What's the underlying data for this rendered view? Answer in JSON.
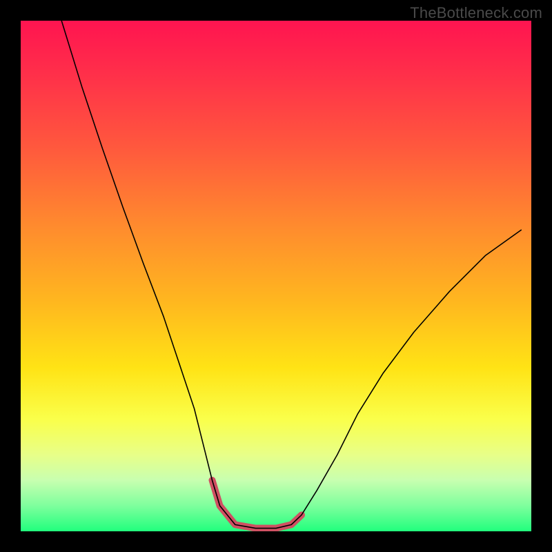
{
  "watermark": "TheBottleneck.com",
  "chart_data": {
    "type": "line",
    "title": "",
    "xlabel": "",
    "ylabel": "",
    "xlim": [
      0,
      100
    ],
    "ylim": [
      0,
      100
    ],
    "grid": false,
    "series": [
      {
        "name": "black-curve",
        "color": "#000000",
        "width": 1.6,
        "x": [
          8,
          12,
          16,
          20,
          24,
          28,
          31,
          34,
          36,
          37.5,
          39,
          42,
          46,
          50,
          53,
          55,
          58,
          62,
          66,
          71,
          77,
          84,
          91,
          98
        ],
        "y": [
          100,
          87,
          75,
          63.5,
          52.5,
          42,
          33,
          24,
          16,
          10,
          5,
          1.3,
          0.6,
          0.6,
          1.3,
          3.2,
          8,
          15,
          23,
          31,
          39,
          47,
          54,
          59
        ]
      },
      {
        "name": "pink-highlight",
        "color": "#cf5062",
        "width": 10,
        "cap": "round",
        "x": [
          37.5,
          39,
          42,
          46,
          50,
          53,
          55
        ],
        "y": [
          10,
          5,
          1.3,
          0.6,
          0.6,
          1.3,
          3.2
        ]
      }
    ]
  }
}
